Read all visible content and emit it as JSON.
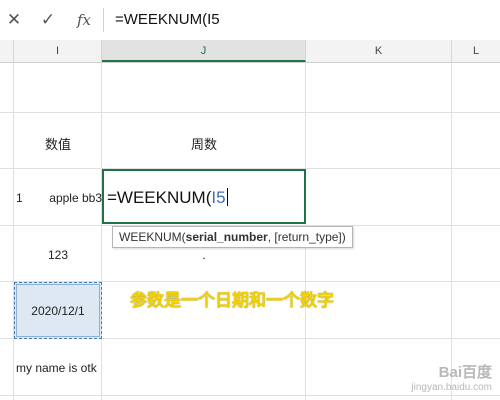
{
  "formula_bar": {
    "cancel_icon": "✕",
    "enter_icon": "✓",
    "fx_label": "fx",
    "formula": "=WEEKNUM(I5"
  },
  "columns": [
    "I",
    "J",
    "K",
    "L"
  ],
  "cells": {
    "i3": "数值",
    "j3": "周数",
    "i4": "1",
    "i4b": "apple bb3",
    "j4_prefix": "=WEEKNUM(",
    "j4_ref": "I5",
    "i5": "123",
    "j5": ".",
    "i6": "2020/12/1",
    "i7": "my name is otk"
  },
  "tooltip": {
    "func": "WEEKNUM(",
    "arg1": "serial_number",
    "rest": ", [return_type])"
  },
  "annotation": "参数是一个日期和一个数字",
  "watermark": {
    "logo": "Bai百度",
    "url": "jingyan.baidu.com"
  }
}
